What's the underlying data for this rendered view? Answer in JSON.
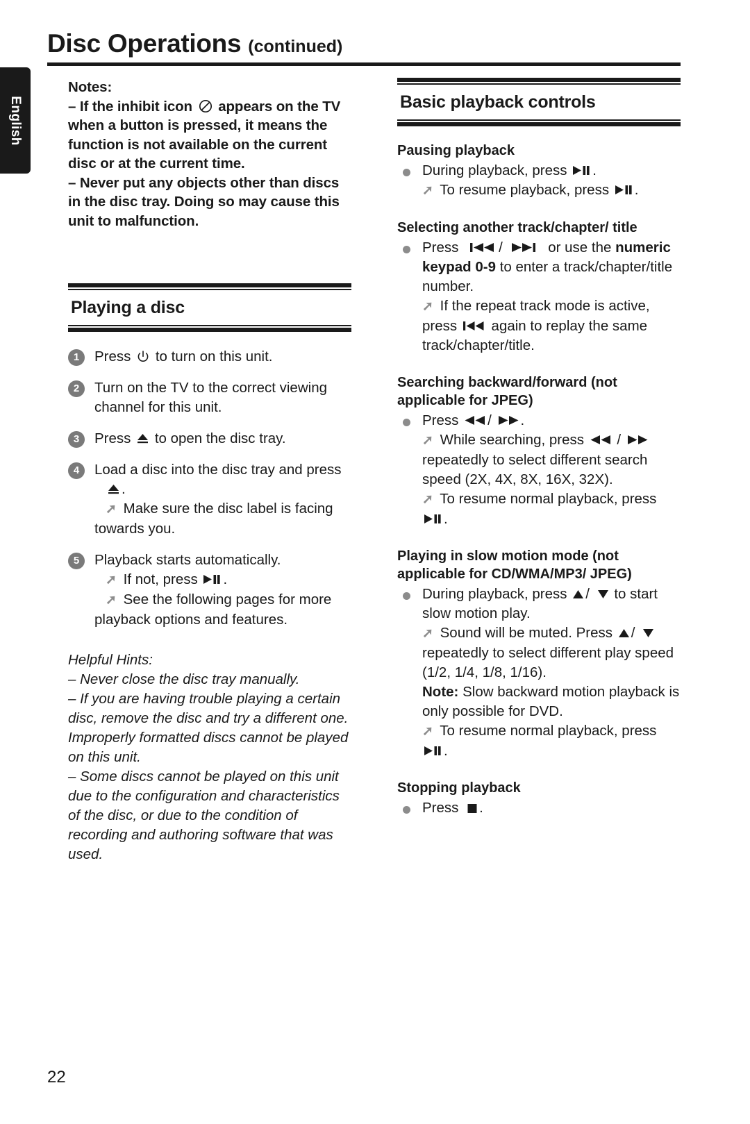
{
  "sidebar": {
    "language_tab": "English"
  },
  "header": {
    "title": "Disc Operations",
    "title_suffix": "(continued)"
  },
  "left_column": {
    "notes": {
      "heading": "Notes:",
      "items": [
        "–  If the inhibit icon",
        "appears on the TV when a button is pressed, it means the function is not available on the current disc or at the current time.",
        "–  Never put any objects other than discs in the disc tray. Doing so may cause this unit to malfunction."
      ]
    },
    "section": {
      "title": "Playing a disc"
    },
    "steps": [
      {
        "number": "1",
        "text_before": "Press",
        "icon": "power-icon",
        "text_after": "to turn on this unit."
      },
      {
        "number": "2",
        "text_before": "Turn on the TV to the correct viewing channel for this unit.",
        "icon": "",
        "text_after": ""
      },
      {
        "number": "3",
        "text_before": "Press",
        "icon": "eject-icon",
        "text_after": "to open the disc tray."
      },
      {
        "number": "4",
        "text_before": "Load a disc into the disc tray and press",
        "icon": "eject-icon",
        "text_after": ".",
        "arrows": [
          "Make sure the disc label is facing towards you."
        ]
      },
      {
        "number": "5",
        "text_before": "Playback starts automatically.",
        "icon": "",
        "text_after": "",
        "arrows": [
          "If not, press",
          "See the following pages for more playback options and features."
        ]
      }
    ],
    "hints": {
      "title": "Helpful Hints:",
      "items": [
        "–  Never close the disc tray manually.",
        "–  If you are having trouble playing a certain disc, remove the disc and try a different one. Improperly formatted discs cannot be played on this unit.",
        "–  Some discs cannot be played on this unit due to the configuration and characteristics of the disc, or due to the condition of recording and authoring software that was used."
      ]
    }
  },
  "right_column": {
    "section": {
      "title": "Basic playback controls"
    },
    "subsections": [
      {
        "heading": "Pausing playback",
        "bullet_before": "During playback, press",
        "bullet_icon": "play-pause-icon",
        "bullet_after": ".",
        "arrows": [
          {
            "text_before": "To resume playback, press",
            "icon": "play-pause-icon",
            "text_after": "."
          }
        ]
      },
      {
        "heading": "Selecting another track/chapter/ title",
        "bullet_before": "Press",
        "bullet_icon": "prev-track-icon",
        "bullet_separator": "/",
        "bullet_icon2": "next-track-icon",
        "bullet_after": "or use the",
        "bullet_bold": "numeric keypad 0-9",
        "bullet_tail": "to enter a track/chapter/title number.",
        "arrows": [
          {
            "text_before": "If the repeat track mode is active, press",
            "icon": "prev-track-icon",
            "text_after": "again to replay the same track/chapter/title."
          }
        ]
      },
      {
        "heading": "Searching backward/forward (not applicable for JPEG)",
        "bullet_before": "Press",
        "bullet_icon": "rewind-icon",
        "bullet_separator": "/",
        "bullet_icon2": "fast-forward-icon",
        "bullet_after": ".",
        "arrows": [
          {
            "text_before": "While searching, press",
            "icon": "rewind-icon",
            "separator": "/",
            "icon2": "fast-forward-icon",
            "text_after": "repeatedly to select different search speed (2X, 4X, 8X, 16X, 32X)."
          },
          {
            "text_before": "To resume normal playback, press",
            "icon": "play-pause-icon",
            "text_after": "."
          }
        ]
      },
      {
        "heading": "Playing in slow motion mode (not applicable for CD/WMA/MP3/ JPEG)",
        "bullet_before": "During playback, press",
        "bullet_icon": "up-arrow-icon",
        "bullet_separator": "/",
        "bullet_icon2": "down-arrow-icon",
        "bullet_after": "to start slow motion play.",
        "arrows": [
          {
            "text_before": "Sound will be muted. Press",
            "icon": "up-arrow-icon",
            "separator": "/",
            "icon2": "down-arrow-icon",
            "text_after": "repeatedly to select different play speed (1/2, 1/4, 1/8, 1/16)."
          }
        ],
        "note_label": "Note:",
        "note_text": "Slow backward motion playback is only possible for DVD.",
        "arrows_after_note": [
          {
            "text_before": "To resume normal playback, press",
            "icon": "play-pause-icon",
            "text_after": "."
          }
        ]
      },
      {
        "heading": "Stopping playback",
        "bullet_before": "Press",
        "bullet_icon": "stop-icon",
        "bullet_after": "."
      }
    ]
  },
  "footer": {
    "page_number": "22"
  },
  "colors": {
    "ink": "#1a1a1a",
    "marker_gray": "#7a7a7a",
    "bullet_gray": "#8c8c8c",
    "tab_background": "#1a1a1a"
  }
}
